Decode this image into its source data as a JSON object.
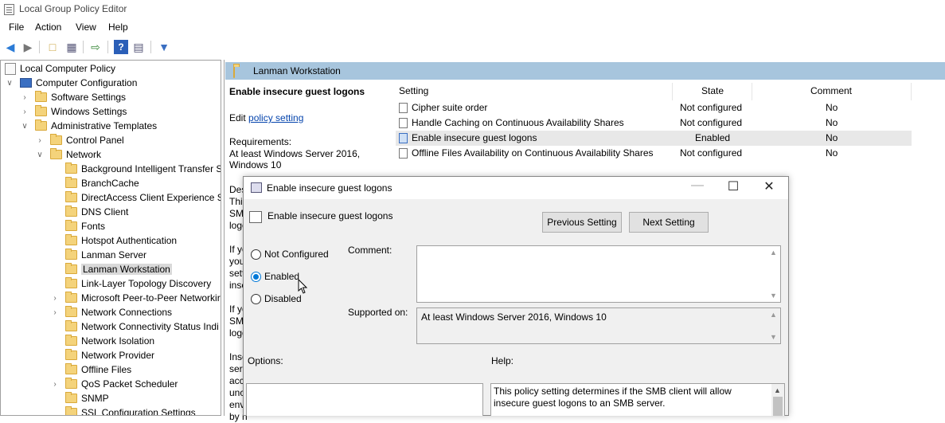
{
  "app": {
    "title": "Local Group Policy Editor"
  },
  "menu": [
    "File",
    "Action",
    "View",
    "Help"
  ],
  "toolbar": {
    "icons": [
      "back-arrow-icon",
      "forward-arrow-icon",
      "up-folder-icon",
      "show-hide-tree-icon",
      "export-list-icon",
      "help-icon",
      "properties-icon",
      "filter-icon"
    ]
  },
  "tree": {
    "root": "Local Computer Policy",
    "items": [
      {
        "label": "Computer Configuration"
      },
      {
        "label": "Software Settings"
      },
      {
        "label": "Windows Settings"
      },
      {
        "label": "Administrative Templates"
      },
      {
        "label": "Control Panel"
      },
      {
        "label": "Network"
      },
      {
        "label": "Background Intelligent Transfer S"
      },
      {
        "label": "BranchCache"
      },
      {
        "label": "DirectAccess Client Experience Se"
      },
      {
        "label": "DNS Client"
      },
      {
        "label": "Fonts"
      },
      {
        "label": "Hotspot Authentication"
      },
      {
        "label": "Lanman Server"
      },
      {
        "label": "Lanman Workstation"
      },
      {
        "label": "Link-Layer Topology Discovery"
      },
      {
        "label": "Microsoft Peer-to-Peer Networkir"
      },
      {
        "label": "Network Connections"
      },
      {
        "label": "Network Connectivity Status Indi"
      },
      {
        "label": "Network Isolation"
      },
      {
        "label": "Network Provider"
      },
      {
        "label": "Offline Files"
      },
      {
        "label": "QoS Packet Scheduler"
      },
      {
        "label": "SNMP"
      },
      {
        "label": "SSL Configuration Settings"
      }
    ]
  },
  "right": {
    "header": "Lanman Workstation",
    "desc_title": "Enable insecure guest logons",
    "edit_prefix": "Edit ",
    "edit_link": "policy setting",
    "req_label": "Requirements:",
    "req_text": "At least Windows Server 2016, Windows 10",
    "fragments": [
      "Des",
      "This",
      "SMB",
      "logo",
      "If yo",
      "you",
      "setti",
      "inse",
      "If yo",
      "SMB",
      "logo",
      "Inse",
      "serv",
      "acce",
      "unc",
      "env",
      "by n"
    ],
    "columns": {
      "setting": "Setting",
      "state": "State",
      "comment": "Comment"
    },
    "rows": [
      {
        "setting": "Cipher suite order",
        "state": "Not configured",
        "comment": "No"
      },
      {
        "setting": "Handle Caching on Continuous Availability Shares",
        "state": "Not configured",
        "comment": "No"
      },
      {
        "setting": "Enable insecure guest logons",
        "state": "Enabled",
        "comment": "No"
      },
      {
        "setting": "Offline Files Availability on Continuous Availability Shares",
        "state": "Not configured",
        "comment": "No"
      }
    ]
  },
  "dialog": {
    "title": "Enable insecure guest logons",
    "subtitle": "Enable insecure guest logons",
    "prev_button": "Previous Setting",
    "next_button": "Next Setting",
    "radios": [
      "Not Configured",
      "Enabled",
      "Disabled"
    ],
    "selected": "Enabled",
    "comment_label": "Comment:",
    "comment_value": "",
    "supported_label": "Supported on:",
    "supported_value": "At least Windows Server 2016, Windows 10",
    "options_label": "Options:",
    "help_label": "Help:",
    "help_text": "This policy setting determines if the SMB client will allow insecure guest logons to an SMB server."
  },
  "colors": {
    "header_bar": "#a7c5dd",
    "selected_radio": "#0078d7",
    "link": "#0645ad"
  }
}
